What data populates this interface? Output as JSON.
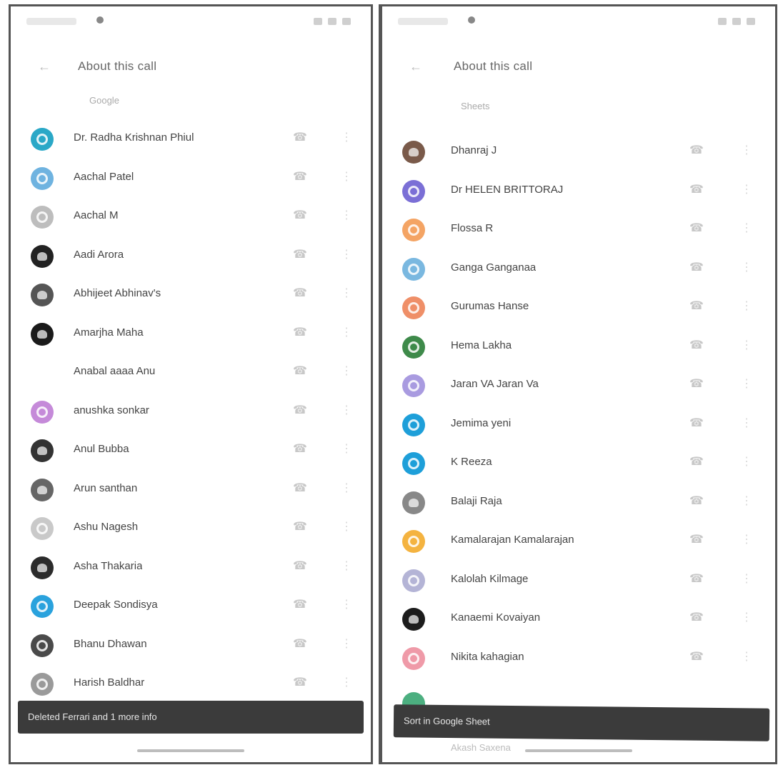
{
  "left": {
    "title": "About this call",
    "list_header": {
      "left": "Google",
      "right": ""
    },
    "snackbar": "Deleted Ferrari and 1 more info",
    "contacts": [
      {
        "name": "Dr. Radha Krishnan Phiul",
        "color": "#2aa8c7",
        "style": "initial"
      },
      {
        "name": "Aachal Patel",
        "color": "#6fb3e0",
        "style": "initial"
      },
      {
        "name": "Aachal M",
        "color": "#bdbdbd",
        "style": "initial"
      },
      {
        "name": "Aadi Arora",
        "color": "#222222",
        "style": "photo"
      },
      {
        "name": "Abhijeet Abhinav's",
        "color": "#555555",
        "style": "photo"
      },
      {
        "name": "Amarjha Maha",
        "color": "#1a1a1a",
        "style": "photo"
      },
      {
        "name": "Anabal aaaa Anu",
        "color": "#ffffff",
        "style": "blank"
      },
      {
        "name": "anushka sonkar",
        "color": "#c58ad9",
        "style": "initial"
      },
      {
        "name": "Anul Bubba",
        "color": "#333333",
        "style": "photo"
      },
      {
        "name": "Arun santhan",
        "color": "#666666",
        "style": "photo"
      },
      {
        "name": "Ashu Nagesh",
        "color": "#c9c9c9",
        "style": "initial"
      },
      {
        "name": "Asha Thakaria",
        "color": "#2b2b2b",
        "style": "photo"
      },
      {
        "name": "Deepak Sondisya",
        "color": "#2aa2dd",
        "style": "initial"
      },
      {
        "name": "Bhanu Dhawan",
        "color": "#4a4a4a",
        "style": "initial"
      },
      {
        "name": "Harish Baldhar",
        "color": "#9a9a9a",
        "style": "initial"
      }
    ]
  },
  "right": {
    "title": "About this call",
    "list_header": {
      "left": "Sheets",
      "right": ""
    },
    "snackbar": "Sort in Google Sheet",
    "peek_name": "Akash Saxena",
    "contacts": [
      {
        "name": "Dhanraj J",
        "color": "#7a5a4a",
        "style": "photo"
      },
      {
        "name": "Dr HELEN BRITTORAJ",
        "color": "#7b6fd6",
        "style": "initial"
      },
      {
        "name": "Flossa R",
        "color": "#f4a464",
        "style": "initial"
      },
      {
        "name": "Ganga Ganganaa",
        "color": "#7ab8e0",
        "style": "initial"
      },
      {
        "name": "Gurumas Hanse",
        "color": "#ef8f68",
        "style": "initial"
      },
      {
        "name": "Hema Lakha",
        "color": "#3e8a4a",
        "style": "initial"
      },
      {
        "name": "Jaran VA Jaran Va",
        "color": "#a99be0",
        "style": "initial"
      },
      {
        "name": "Jemima yeni",
        "color": "#1e9fd9",
        "style": "initial"
      },
      {
        "name": "K Reeza",
        "color": "#1e9fd9",
        "style": "initial"
      },
      {
        "name": "Balaji Raja",
        "color": "#888888",
        "style": "photo"
      },
      {
        "name": "Kamalarajan Kamalarajan",
        "color": "#f4b340",
        "style": "initial"
      },
      {
        "name": "Kalolah Kilmage",
        "color": "#b4b4d6",
        "style": "initial"
      },
      {
        "name": "Kanaemi Kovaiyan",
        "color": "#1c1c1c",
        "style": "photo"
      },
      {
        "name": "Nikita kahagian",
        "color": "#ef9aa8",
        "style": "initial"
      }
    ]
  }
}
